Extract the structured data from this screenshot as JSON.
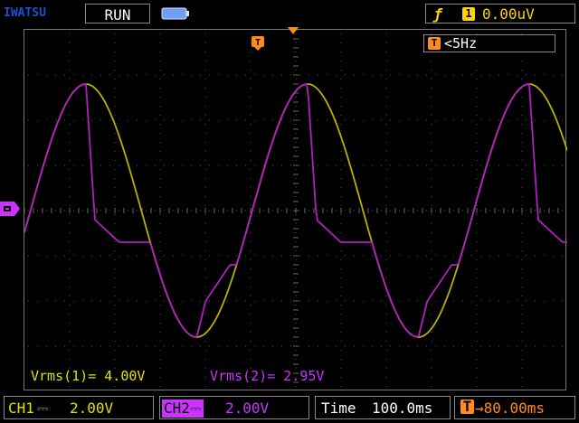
{
  "top": {
    "brand": "IWATSU",
    "status": "RUN",
    "trigger": {
      "edge_symbol": "ƒ",
      "source": "1",
      "level": "0.00uV"
    }
  },
  "screen": {
    "frequency_label": "T",
    "frequency": "<5Hz",
    "trigger_marker": "T",
    "measurements": {
      "m1": "Vrms(1)= 4.00V",
      "m2": "Vrms(2)= 2.95V"
    }
  },
  "bottom": {
    "ch1_label": "CH1",
    "ch1_coupling": "⎓",
    "ch1_scale": "2.00V",
    "ch2_label": "CH2",
    "ch2_coupling": "⎓",
    "ch2_scale": "2.00V",
    "time_label": "Time",
    "time_value": "100.0ms",
    "trig_delay_icon": "T",
    "trig_delay": "→80.00ms"
  },
  "colors": {
    "ch1": "#b8b000",
    "ch2": "#b020c0",
    "trigger": "#ffd400",
    "orange": "#ff8c1a",
    "brand": "#1f4fd1"
  },
  "icons": [
    "battery-icon",
    "trigger-edge-icon",
    "trigger-position-icon",
    "channel-ground-marker-icon"
  ]
}
